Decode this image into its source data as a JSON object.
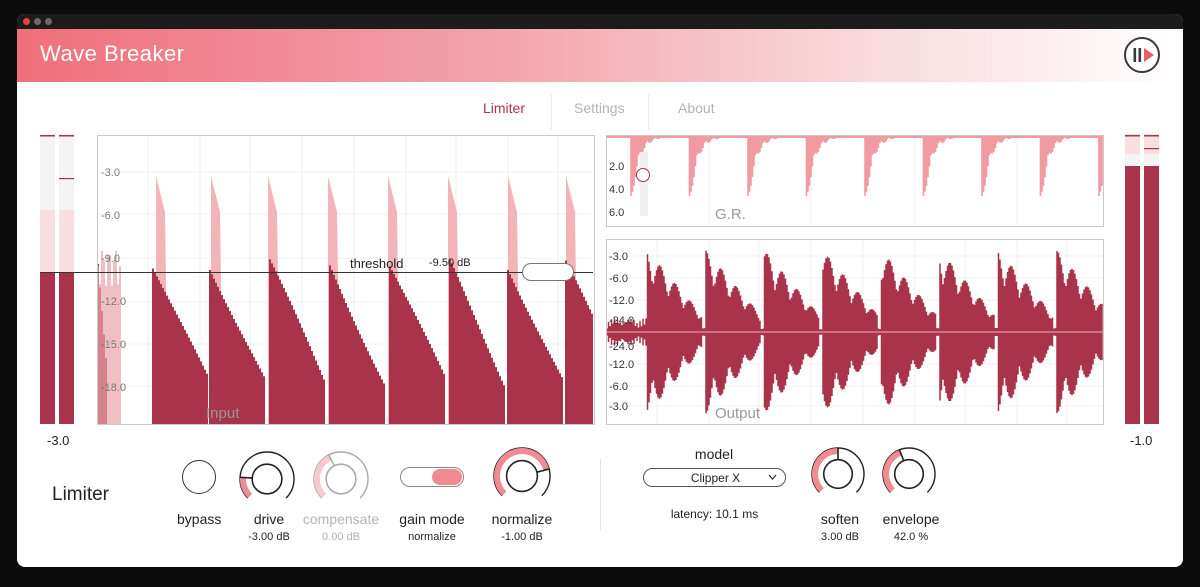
{
  "app": {
    "title": "Wave Breaker"
  },
  "tabs": [
    {
      "label": "Limiter",
      "active": true
    },
    {
      "label": "Settings",
      "active": false
    },
    {
      "label": "About",
      "active": false
    }
  ],
  "colors": {
    "accent": "#a8334a",
    "accent_light": "#f08a93",
    "pink_bg": "#f7e4e6",
    "inactive_text": "#b3b3b3"
  },
  "input_meter": {
    "value": "-3.0"
  },
  "output_meter": {
    "value": "-1.0"
  },
  "input_graph": {
    "ticks": [
      "-3.0",
      "-6.0",
      "-9.0",
      "-12.0",
      "-15.0",
      "-18.0"
    ],
    "label": "Input",
    "threshold_label": "threshold",
    "threshold_value": "-9.50 dB"
  },
  "gr_graph": {
    "ticks": [
      "2.0",
      "4.0",
      "6.0"
    ],
    "label": "G.R."
  },
  "output_graph": {
    "ticks": [
      "-3.0",
      "-6.0",
      "-12.0",
      "-24.0",
      "-24.0",
      "-12.0",
      "-6.0",
      "-3.0"
    ],
    "label": "Output"
  },
  "section": {
    "title": "Limiter"
  },
  "controls": {
    "bypass": {
      "label": "bypass"
    },
    "drive": {
      "label": "drive",
      "value": "-3.00 dB",
      "level": 0.18
    },
    "compensate": {
      "label": "compensate",
      "value": "0.00 dB",
      "level": 0.4
    },
    "gain_mode": {
      "label": "gain mode",
      "value": "normalize"
    },
    "normalize": {
      "label": "normalize",
      "value": "-1.00 dB",
      "level": 0.78
    },
    "model": {
      "label": "model",
      "selected": "Clipper X"
    },
    "latency": {
      "text": "latency: 10.1 ms"
    },
    "soften": {
      "label": "soften",
      "value": "3.00 dB",
      "level": 0.5
    },
    "envelope": {
      "label": "envelope",
      "value": "42.0 %",
      "level": 0.42
    }
  }
}
